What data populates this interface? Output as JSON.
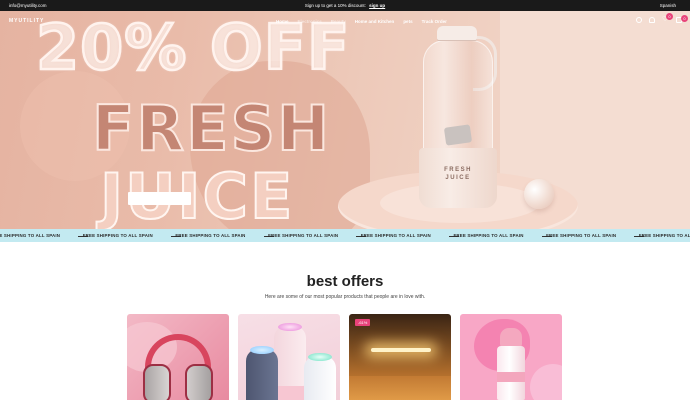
{
  "topbar": {
    "email": "info@myutility.com",
    "promo_text": "Sign up to get a 10% discount",
    "promo_link": "sign up",
    "language": "Spanish"
  },
  "header": {
    "logo": "MYUTILITY",
    "nav": [
      "Home",
      "Electronics",
      "Beauty",
      "Home and Kitchen",
      "pets",
      "Track Order"
    ],
    "cart_count": "0",
    "wishlist_count": "0"
  },
  "hero": {
    "headline": "20% OFF",
    "line1": "FRESH",
    "line2": "JUICE",
    "product_brand_line1": "FRESH",
    "product_brand_line2": "JUICE"
  },
  "marquee": {
    "text": "FREE SHIPPING TO ALL SPAIN",
    "repeat": 8
  },
  "offers": {
    "title": "best offers",
    "subtitle": "Here are some of our most popular products that people are in love with.",
    "products": [
      {
        "name": "headphones",
        "badge": ""
      },
      {
        "name": "humidifier",
        "badge": ""
      },
      {
        "name": "led-light",
        "badge": "-61%"
      },
      {
        "name": "pink-bottle",
        "badge": ""
      }
    ]
  },
  "colors": {
    "topbar": "#1a1a1a",
    "marquee_bg": "#c3eaf1",
    "badge": "#e8437a",
    "hero_bg": "#e9bba9"
  }
}
